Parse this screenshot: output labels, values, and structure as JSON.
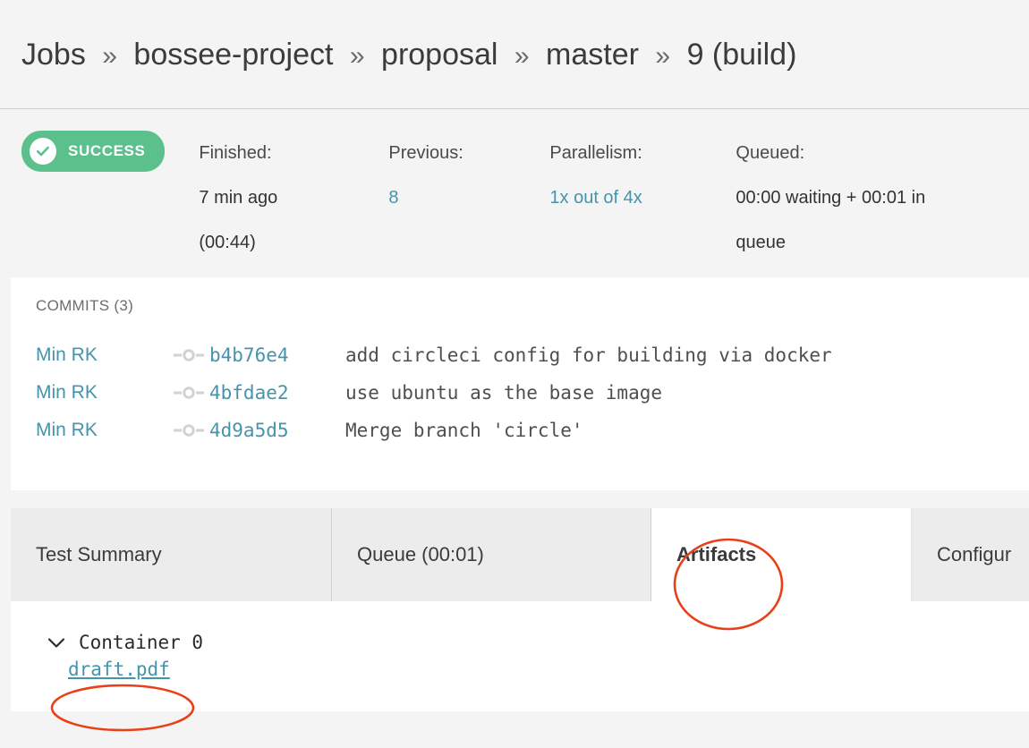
{
  "colors": {
    "page_background": "#f4f4f4",
    "panel_background": "#ffffff",
    "success_green": "#5cc08c",
    "link_teal": "#4694ab",
    "annotation_red": "#e8411a",
    "tab_inactive": "#ececec",
    "text_primary": "#333333"
  },
  "header": {
    "breadcrumb": [
      {
        "label": "Jobs"
      },
      {
        "label": "bossee-project"
      },
      {
        "label": "proposal"
      },
      {
        "label": "master"
      },
      {
        "label": "9 (build)"
      }
    ],
    "separator": "»"
  },
  "status": {
    "badge": {
      "label": "SUCCESS",
      "icon": "check-circle-icon"
    },
    "stats": [
      {
        "key": "finished",
        "label": "Finished:",
        "value": "7 min ago",
        "value2": "(00:44)",
        "is_link": false
      },
      {
        "key": "previous",
        "label": "Previous:",
        "value": "8",
        "is_link": true
      },
      {
        "key": "parallelism",
        "label": "Parallelism:",
        "value": "1x out of 4x",
        "is_link": true
      },
      {
        "key": "queued",
        "label": "Queued:",
        "value": "00:00 waiting + 00:01 in",
        "value2": "queue",
        "is_link": false
      }
    ]
  },
  "commits": {
    "title": "COMMITS (3)",
    "count": 3,
    "rows": [
      {
        "author": "Min RK",
        "hash": "b4b76e4",
        "subject": "add circleci config for building via docker",
        "icon": "commit-node-icon"
      },
      {
        "author": "Min RK",
        "hash": "4bfdae2",
        "subject": "use ubuntu as the base image",
        "icon": "commit-node-icon"
      },
      {
        "author": "Min RK",
        "hash": "4d9a5d5",
        "subject": "Merge branch 'circle'",
        "icon": "commit-node-icon"
      }
    ]
  },
  "tabs": [
    {
      "key": "test-summary",
      "label": "Test Summary",
      "active": false
    },
    {
      "key": "queue",
      "label": "Queue (00:01)",
      "active": false
    },
    {
      "key": "artifacts",
      "label": "Artifacts",
      "active": true,
      "annotated": true
    },
    {
      "key": "configuration",
      "label": "Configur",
      "active": false,
      "clipped": true
    }
  ],
  "artifacts": {
    "container": {
      "label": "Container 0",
      "expander_icon": "chevron-down-icon",
      "expanded": true
    },
    "files": [
      {
        "name": "draft.pdf",
        "annotated": true
      }
    ]
  },
  "annotations": [
    {
      "target": "tab-artifacts",
      "shape": "ellipse",
      "color": "#e8411a"
    },
    {
      "target": "artifact-draft-pdf",
      "shape": "ellipse",
      "color": "#e8411a"
    }
  ]
}
